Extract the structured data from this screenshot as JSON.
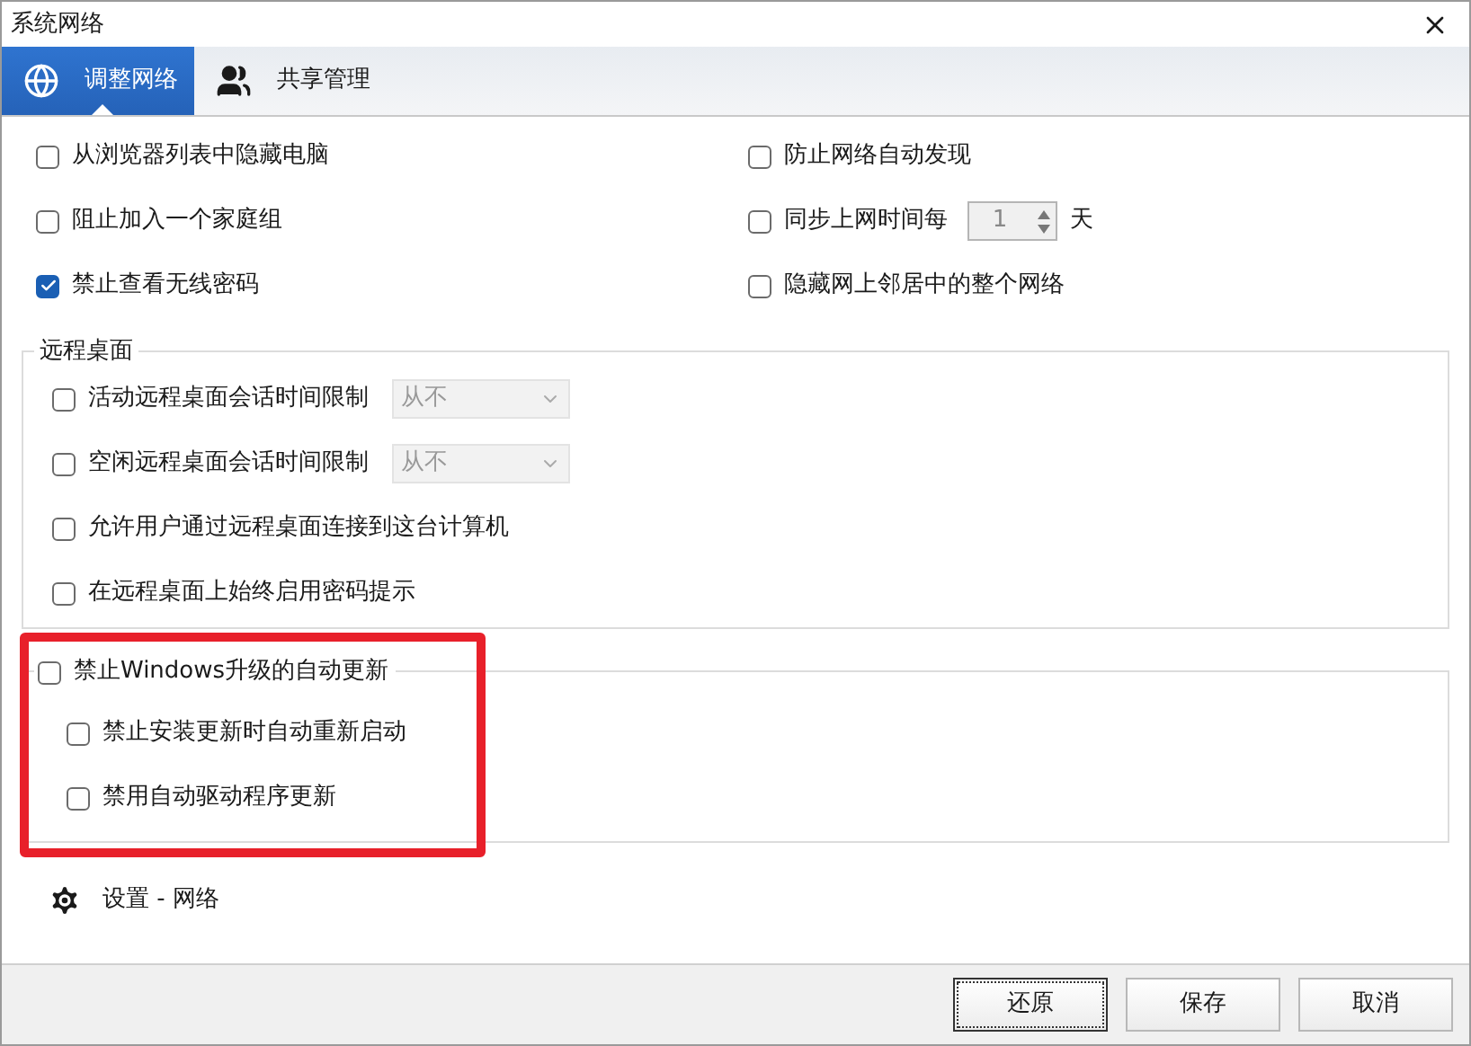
{
  "window": {
    "title": "系统网络"
  },
  "tabs": [
    {
      "label": "调整网络",
      "kind": "globe",
      "selected": true
    },
    {
      "label": "共享管理",
      "kind": "users",
      "selected": false
    }
  ],
  "options_left": [
    {
      "label": "从浏览器列表中隐藏电脑",
      "checked": false
    },
    {
      "label": "阻止加入一个家庭组",
      "checked": false
    },
    {
      "label": "禁止查看无线密码",
      "checked": true
    }
  ],
  "options_right": [
    {
      "kind": "plain",
      "label": "防止网络自动发现",
      "checked": false
    },
    {
      "kind": "spin",
      "label": "同步上网时间每",
      "checked": false,
      "value": "1",
      "unit": "天"
    },
    {
      "kind": "plain",
      "label": "隐藏网上邻居中的整个网络",
      "checked": false
    }
  ],
  "remote_desktop": {
    "title": "远程桌面",
    "options": [
      {
        "kind": "select",
        "label": "活动远程桌面会话时间限制",
        "checked": false,
        "value": "从不"
      },
      {
        "kind": "select",
        "label": "空闲远程桌面会话时间限制",
        "checked": false,
        "value": "从不"
      },
      {
        "kind": "plain",
        "label": "允许用户通过远程桌面连接到这台计算机",
        "checked": false
      },
      {
        "kind": "plain",
        "label": "在远程桌面上始终启用密码提示",
        "checked": false
      }
    ]
  },
  "windows_update": {
    "label": "禁止Windows升级的自动更新",
    "checked": false,
    "highlighted": true,
    "options": [
      {
        "label": "禁止安装更新时自动重新启动",
        "checked": false
      },
      {
        "label": "禁用自动驱动程序更新",
        "checked": false
      }
    ]
  },
  "settings_link": "设置 - 网络",
  "buttons": [
    {
      "label": "还原",
      "focused": true
    },
    {
      "label": "保存",
      "focused": false
    },
    {
      "label": "取消",
      "focused": false
    }
  ]
}
